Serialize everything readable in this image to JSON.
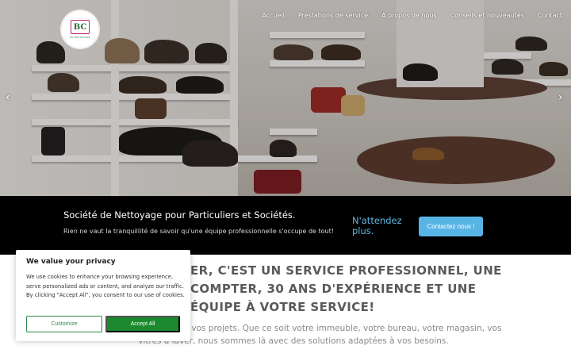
{
  "brand": {
    "logo_text": "BC",
    "logo_small": "BC NETTOYAGE",
    "accent": "#c41e6a",
    "green": "#2c6e3b"
  },
  "nav": {
    "items": [
      {
        "label": "Accueil"
      },
      {
        "label": "Prestations de service"
      },
      {
        "label": "A propos de nous"
      },
      {
        "label": "Conseils et nouveautés"
      },
      {
        "label": "Contact"
      }
    ]
  },
  "slider": {
    "prev_icon": "chevron-left-icon",
    "next_icon": "chevron-right-icon",
    "prev_glyph": "‹",
    "next_glyph": "›"
  },
  "band": {
    "heading": "Société de Nettoyage pour Particuliers et Sociétés.",
    "text": "Rien ne vaut la tranquillité de savoir qu'une équipe professionnelle s'occupe de tout!",
    "cta_text": "N'attendez plus.",
    "button_label": "Contactez nous !",
    "background": "#000000",
    "cta_color": "#5fb6e6",
    "button_color": "#59b4e6"
  },
  "main": {
    "headline": "...ER, C'EST UN SERVICE PROFESSIONNEL, UNE ... COMPTER, 30 ANS D'EXPÉRIENCE ET UNE ÉQUIPE À VOTRE SERVICE!",
    "headline_lines": [
      "ER, C'EST UN SERVICE PROFESSIONNEL, UNE",
      "COMPTER, 30 ANS D'EXPÉRIENCE ET UNE",
      "ÉQUIPE À VOTRE SERVICE!"
    ],
    "paragraph": "tact avec nous pour tous vos projets. Que ce soit votre immeuble, votre bureau, votre magasin, vos vitres à laver, nous sommes là avec des solutions adaptées à vos besoins."
  },
  "cookie": {
    "title": "We value your privacy",
    "body": "We use cookies to enhance your browsing experience, serve personalized ads or content, and analyze our traffic. By clicking \"Accept All\", you consent to our use of cookies.",
    "customize_label": "Customize",
    "accept_label": "Accept All",
    "accept_color": "#1b8a2e"
  }
}
